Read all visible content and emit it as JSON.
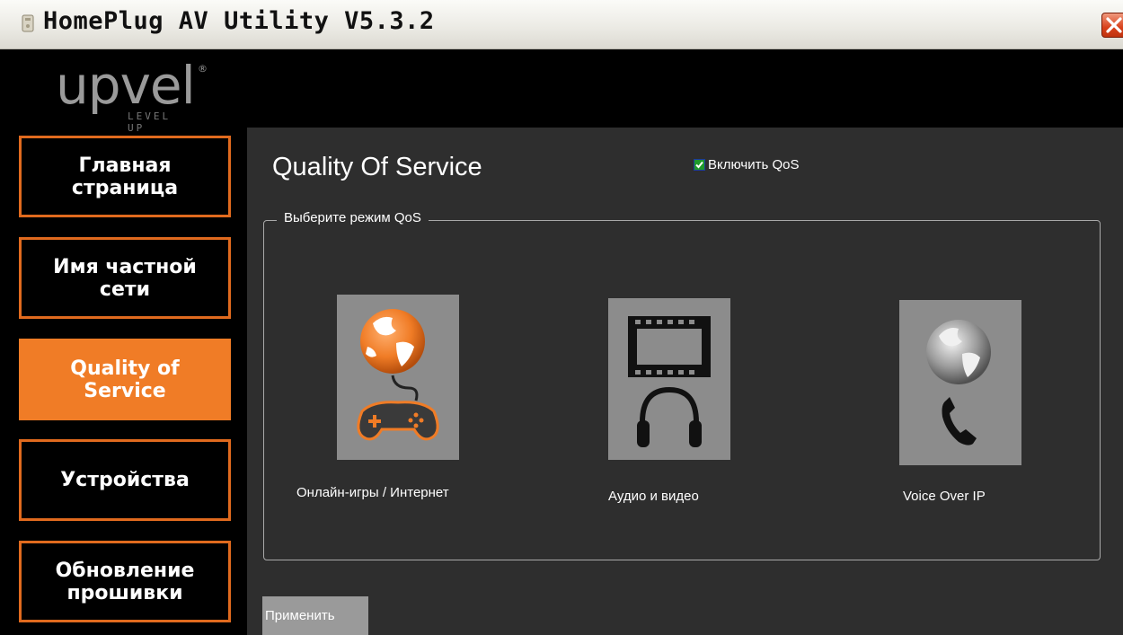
{
  "window": {
    "title": "HomePlug AV Utility V5.3.2",
    "close_icon": "close-icon"
  },
  "logo": {
    "text": "upvel",
    "reg": "®",
    "tagline": "LEVEL UP"
  },
  "sidebar": {
    "items": [
      {
        "label": "Главная\nстраница",
        "active": false
      },
      {
        "label": "Имя частной\nсети",
        "active": false
      },
      {
        "label": "Quality of\nService",
        "active": true
      },
      {
        "label": "Устройства",
        "active": false
      },
      {
        "label": "Обновление\nпрошивки",
        "active": false
      }
    ]
  },
  "main": {
    "title": "Quality Of Service",
    "enable_qos": {
      "label": "Включить QoS",
      "checked": true
    },
    "group": {
      "legend": "Выберите режим QoS",
      "modes": [
        {
          "label": "Онлайн-игры / Интернет",
          "icon": "globe-gamepad-icon"
        },
        {
          "label": "Аудио и видео",
          "icon": "film-headphones-icon"
        },
        {
          "label": "Voice Over IP",
          "icon": "globe-phone-icon"
        }
      ]
    },
    "apply_label": "Применить"
  },
  "colors": {
    "accent": "#f07c26",
    "panel": "#2e2e2e",
    "tile": "#8c8c8c"
  }
}
